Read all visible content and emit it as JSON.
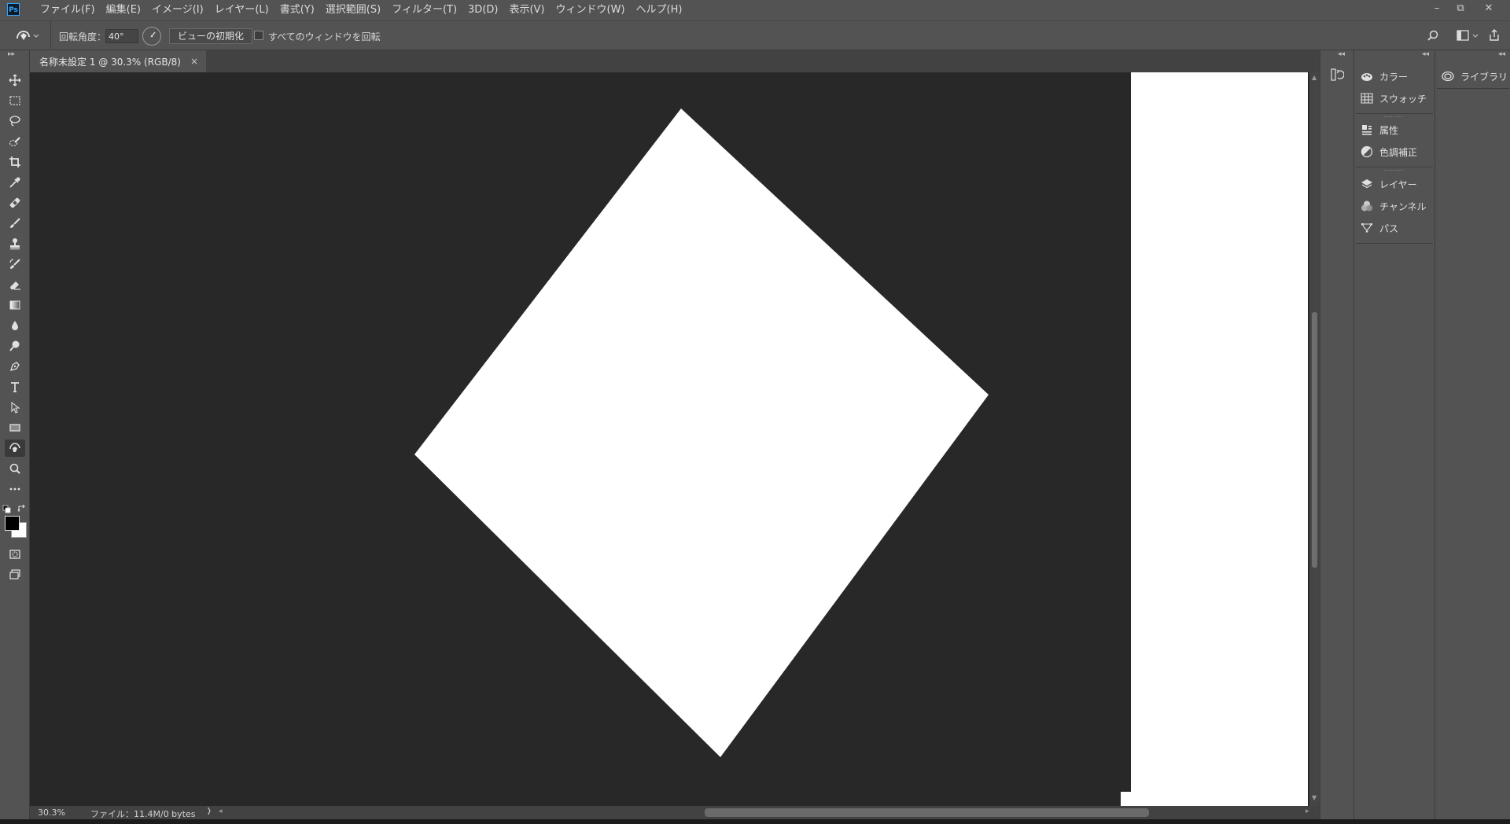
{
  "app": {
    "logo_text": "Ps"
  },
  "menu": [
    "ファイル(F)",
    "編集(E)",
    "イメージ(I)",
    "レイヤー(L)",
    "書式(Y)",
    "選択範囲(S)",
    "フィルター(T)",
    "3D(D)",
    "表示(V)",
    "ウィンドウ(W)",
    "ヘルプ(H)"
  ],
  "window_controls": {
    "minimize": "–",
    "restore": "⧉",
    "close": "✕"
  },
  "options": {
    "rotation_label": "回転角度：",
    "rotation_value": "40°",
    "reset_view_button": "ビューの初期化",
    "rotate_all_label": "すべてのウィンドウを回転",
    "rotate_all_checked": false
  },
  "document_tab": {
    "title": "名称未設定 1 @ 30.3% (RGB/8)",
    "close": "×"
  },
  "canvas": {
    "rotation_degrees": 40,
    "background_color": "#282828",
    "document_color": "#ffffff"
  },
  "status": {
    "zoom": "30.3%",
    "file_info": "ファイル：11.4M/0 bytes",
    "arrow": "❭"
  },
  "tools": [
    {
      "name": "move-tool",
      "icon": "move"
    },
    {
      "name": "marquee-tool",
      "icon": "marquee"
    },
    {
      "name": "lasso-tool",
      "icon": "lasso"
    },
    {
      "name": "quick-select-tool",
      "icon": "quick-select"
    },
    {
      "name": "crop-tool",
      "icon": "crop"
    },
    {
      "name": "eyedropper-tool",
      "icon": "eyedropper"
    },
    {
      "name": "healing-brush-tool",
      "icon": "bandage"
    },
    {
      "name": "brush-tool",
      "icon": "brush"
    },
    {
      "name": "clone-stamp-tool",
      "icon": "stamp"
    },
    {
      "name": "history-brush-tool",
      "icon": "history-brush"
    },
    {
      "name": "eraser-tool",
      "icon": "eraser"
    },
    {
      "name": "gradient-tool",
      "icon": "gradient"
    },
    {
      "name": "blur-tool",
      "icon": "drop"
    },
    {
      "name": "dodge-tool",
      "icon": "dodge"
    },
    {
      "name": "pen-tool",
      "icon": "pen"
    },
    {
      "name": "type-tool",
      "icon": "type"
    },
    {
      "name": "path-select-tool",
      "icon": "arrow"
    },
    {
      "name": "rectangle-tool",
      "icon": "rectangle"
    },
    {
      "name": "rotate-view-tool",
      "icon": "rotate-hand",
      "active": true
    },
    {
      "name": "zoom-tool",
      "icon": "zoom"
    },
    {
      "name": "more-tools",
      "icon": "ellipsis"
    }
  ],
  "colors": {
    "foreground": "#000000",
    "background": "#ffffff"
  },
  "panels": {
    "group1": [
      {
        "label": "カラー",
        "icon": "color-palette-icon"
      },
      {
        "label": "スウォッチ",
        "icon": "swatches-grid-icon"
      }
    ],
    "group2": [
      {
        "label": "属性",
        "icon": "properties-icon"
      },
      {
        "label": "色調補正",
        "icon": "adjustments-icon"
      }
    ],
    "group3": [
      {
        "label": "レイヤー",
        "icon": "layers-icon"
      },
      {
        "label": "チャンネル",
        "icon": "channels-icon"
      },
      {
        "label": "パス",
        "icon": "paths-icon"
      }
    ],
    "library": {
      "label": "ライブラリ",
      "icon": "cc-libraries-icon"
    }
  }
}
